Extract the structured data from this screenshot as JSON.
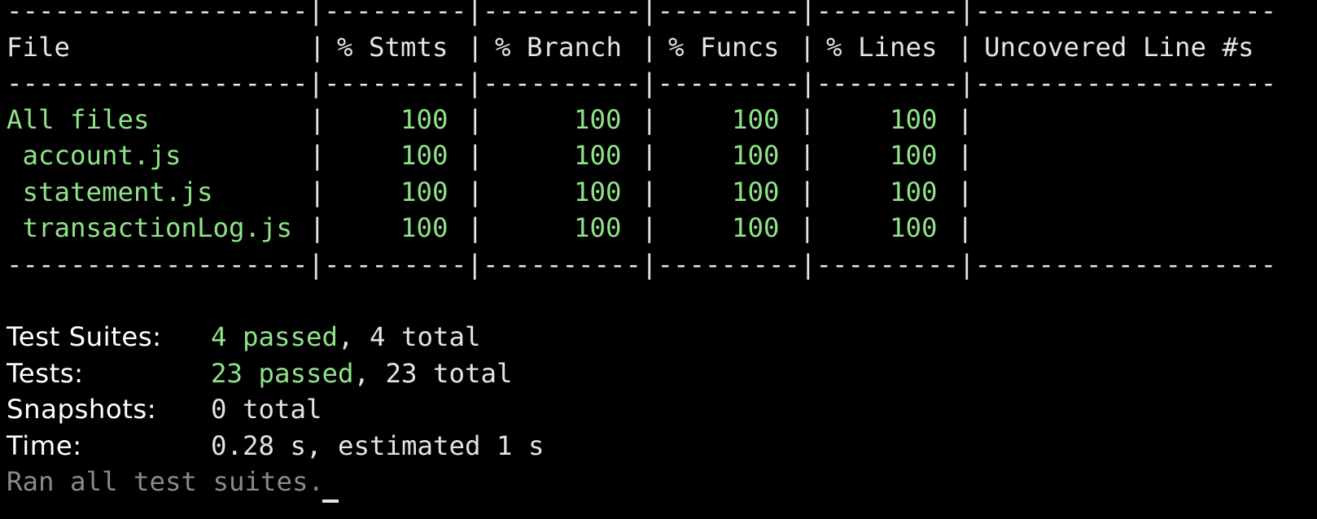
{
  "coverage_table": {
    "separator": "-------------------|---------|----------|---------|---------|-------------------",
    "header": {
      "file": "File",
      "stmts": "% Stmts",
      "branch": "% Branch",
      "funcs": "% Funcs",
      "lines": "% Lines",
      "uncovered": "Uncovered Line #s"
    },
    "rows": [
      {
        "file": "All files",
        "stmts": "100",
        "branch": "100",
        "funcs": "100",
        "lines": "100",
        "uncovered": ""
      },
      {
        "file": " account.js",
        "stmts": "100",
        "branch": "100",
        "funcs": "100",
        "lines": "100",
        "uncovered": ""
      },
      {
        "file": " statement.js",
        "stmts": "100",
        "branch": "100",
        "funcs": "100",
        "lines": "100",
        "uncovered": ""
      },
      {
        "file": " transactionLog.js",
        "stmts": "100",
        "branch": "100",
        "funcs": "100",
        "lines": "100",
        "uncovered": ""
      }
    ]
  },
  "summary": {
    "test_suites": {
      "label": "Test Suites:",
      "passed": "4 passed",
      "rest": ", 4 total"
    },
    "tests": {
      "label": "Tests:",
      "passed": "23 passed",
      "rest": ", 23 total"
    },
    "snapshots": {
      "label": "Snapshots:",
      "value": "0 total"
    },
    "time": {
      "label": "Time:",
      "value": "0.28 s, estimated 1 s"
    },
    "footer": "Ran all test suites."
  },
  "colors": {
    "background": "#000000",
    "pass_green": "#8fe388",
    "text": "#e4e4e4",
    "dim": "#8a8a8a"
  }
}
